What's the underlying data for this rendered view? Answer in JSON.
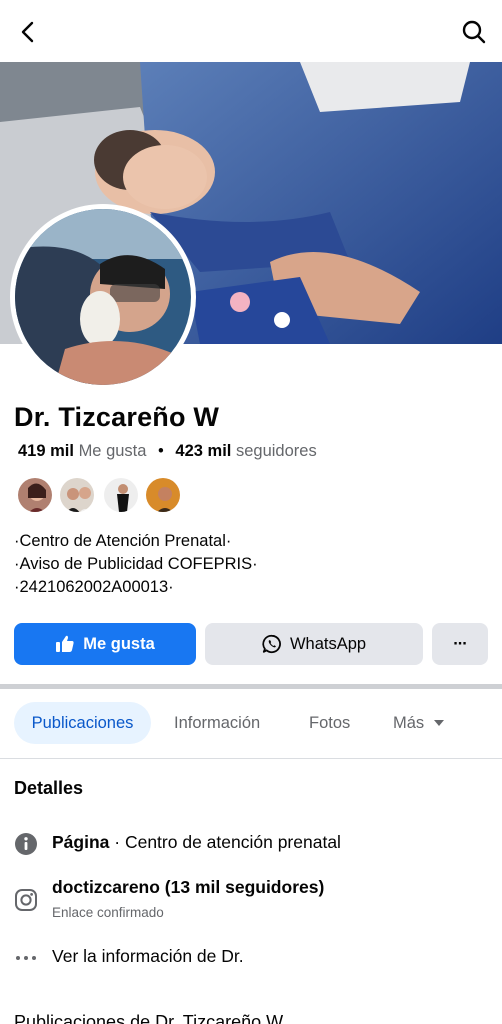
{
  "profile": {
    "name": "Dr. Tizcareño W",
    "likes_count": "419 mil",
    "likes_label": "Me gusta",
    "followers_count": "423 mil",
    "followers_label": "seguidores",
    "bio_lines": [
      "·Centro de Atención Prenatal·",
      "·Aviso de Publicidad COFEPRIS·",
      "·2421062002A00013·"
    ]
  },
  "actions": {
    "like_label": "Me gusta",
    "whatsapp_label": "WhatsApp",
    "more_label": "···"
  },
  "tabs": {
    "posts": "Publicaciones",
    "info": "Información",
    "photos": "Fotos",
    "more": "Más"
  },
  "details": {
    "title": "Detalles",
    "page_type_label": "Página",
    "page_type_value": "· Centro de atención prenatal",
    "instagram_handle": "doctizcareno (13 mil seguidores)",
    "instagram_sub": "Enlace confirmado",
    "see_info": "Ver la información de Dr."
  },
  "posts_section_title": "Publicaciones de Dr. Tizcareño W",
  "colors": {
    "accent": "#1877f2",
    "tab_active_bg": "#e7f3ff",
    "tab_active_text": "#0a58ca",
    "button_grey": "#e4e6eb",
    "muted_text": "#65676b"
  },
  "icons": {
    "back": "chevron-left-icon",
    "search": "search-icon",
    "like": "thumbs-up-icon",
    "whatsapp": "whatsapp-icon",
    "info": "info-icon",
    "instagram": "instagram-icon",
    "more": "ellipsis-icon"
  }
}
